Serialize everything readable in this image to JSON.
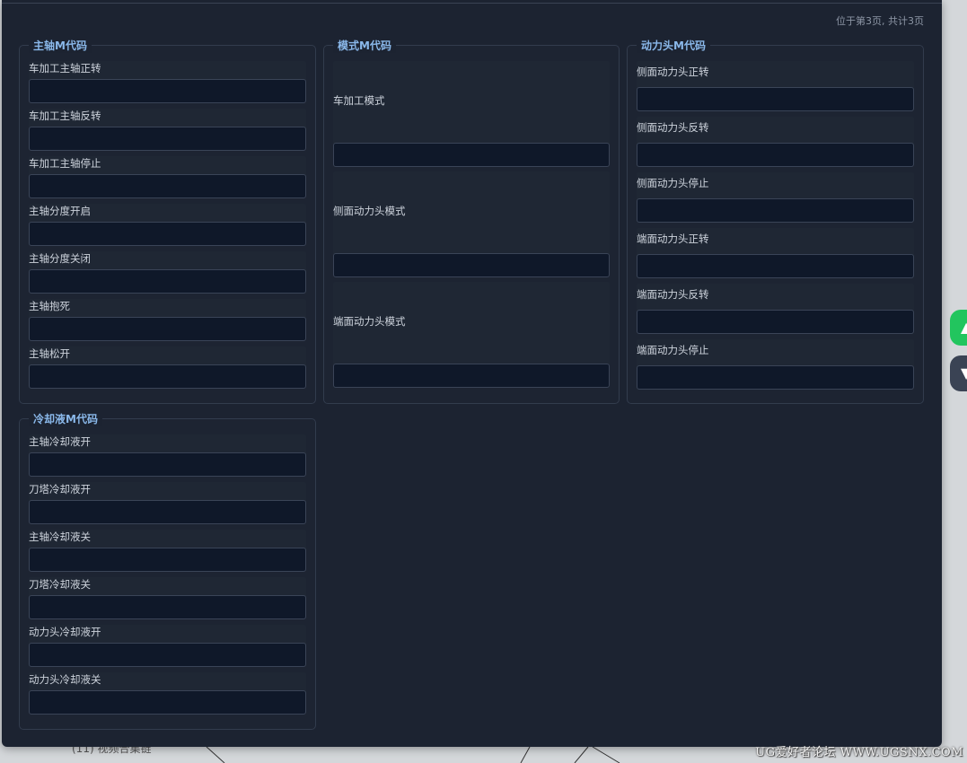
{
  "page_info": "位于第3页, 共计3页",
  "sections": {
    "spindle": {
      "title": "主轴M代码",
      "fields": [
        {
          "label": "车加工主轴正转",
          "value": ""
        },
        {
          "label": "车加工主轴反转",
          "value": ""
        },
        {
          "label": "车加工主轴停止",
          "value": ""
        },
        {
          "label": "主轴分度开启",
          "value": ""
        },
        {
          "label": "主轴分度关闭",
          "value": ""
        },
        {
          "label": "主轴抱死",
          "value": ""
        },
        {
          "label": "主轴松开",
          "value": ""
        }
      ]
    },
    "mode": {
      "title": "模式M代码",
      "fields": [
        {
          "label": "车加工模式",
          "value": ""
        },
        {
          "label": "侧面动力头模式",
          "value": ""
        },
        {
          "label": "端面动力头模式",
          "value": ""
        }
      ]
    },
    "live_tool": {
      "title": "动力头M代码",
      "fields": [
        {
          "label": "侧面动力头正转",
          "value": ""
        },
        {
          "label": "侧面动力头反转",
          "value": ""
        },
        {
          "label": "侧面动力头停止",
          "value": ""
        },
        {
          "label": "端面动力头正转",
          "value": ""
        },
        {
          "label": "端面动力头反转",
          "value": ""
        },
        {
          "label": "端面动力头停止",
          "value": ""
        }
      ]
    },
    "coolant": {
      "title": "冷却液M代码",
      "fields": [
        {
          "label": "主轴冷却液开",
          "value": ""
        },
        {
          "label": "刀塔冷却液开",
          "value": ""
        },
        {
          "label": "主轴冷却液关",
          "value": ""
        },
        {
          "label": "刀塔冷却液关",
          "value": ""
        },
        {
          "label": "动力头冷却液开",
          "value": ""
        },
        {
          "label": "动力头冷却液关",
          "value": ""
        }
      ]
    }
  },
  "side_buttons": {
    "up": {
      "icon": "arrow-up-icon",
      "color": "#22c55e",
      "glyph": "▲"
    },
    "down": {
      "icon": "arrow-down-icon",
      "color": "#3a4354",
      "glyph": "▼"
    }
  },
  "bottom_text": "(11)    视频合集链",
  "watermark": "UG爱好者论坛 WWW.UGSNX.COM",
  "colors": {
    "panel_bg": "#1c2331",
    "legend": "#8ab8ea",
    "input_bg": "#0f1829",
    "border": "#323c4d"
  }
}
